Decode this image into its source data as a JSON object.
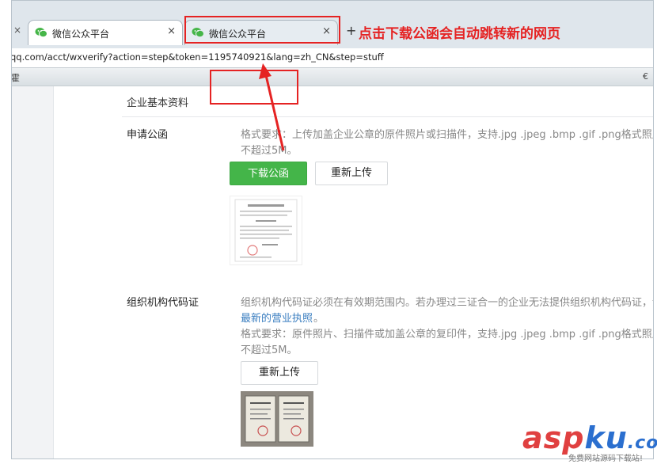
{
  "browser": {
    "tabs": [
      {
        "title": "微信公众平台",
        "close": "×"
      },
      {
        "title": "微信公众平台",
        "close": "×"
      }
    ],
    "left_close": "×",
    "new_tab": "+",
    "url": "qq.com/acct/wxverify?action=step&token=1195740921&lang=zh_CN&step=stuff",
    "bookmark_left": "霍",
    "bookmark_right": "€"
  },
  "annotation": {
    "text": "点击下载公函会自动跳转新的网页",
    "color": "#e52323"
  },
  "page": {
    "section_title": "企业基本资料",
    "letter": {
      "label": "申请公函",
      "desc_line1": "格式要求：上传加盖企业公章的原件照片或扫描件，支持.jpg .jpeg .bmp .gif .png格式照片",
      "desc_line2": "不超过5M。",
      "download_button": "下载公函",
      "reupload_button": "重新上传"
    },
    "org_code": {
      "label": "组织机构代码证",
      "desc_line1": "组织机构代码证必须在有效期范围内。若办理过三证合一的企业无法提供组织机构代码证，请",
      "link": "最新的营业执照",
      "link_suffix": "。",
      "desc_line3": "格式要求：原件照片、扫描件或加盖公章的复印件，支持.jpg .jpeg .bmp .gif .png格式照片",
      "desc_line4": "不超过5M。",
      "reupload_button": "重新上传"
    }
  },
  "watermark": {
    "brand_a": "asp",
    "brand_b": "ku",
    "brand_c": ".com",
    "tagline": "免费网站源码下载站!"
  },
  "colors": {
    "green": "#44b549",
    "link": "#3a7ec0",
    "accent_red": "#e52323"
  }
}
